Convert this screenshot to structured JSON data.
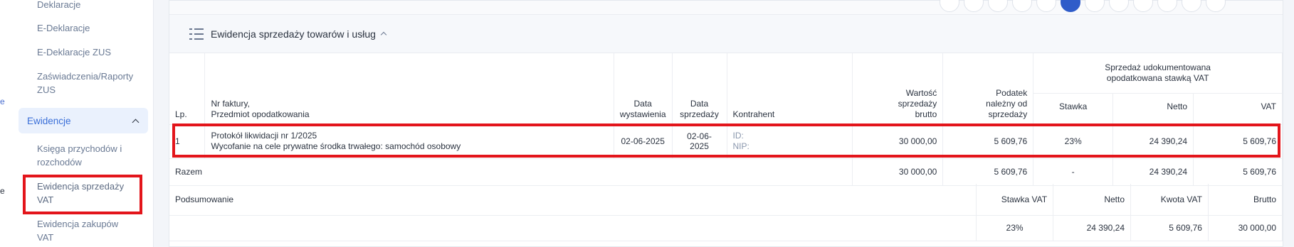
{
  "sidebar": {
    "items": [
      {
        "label": "Deklaracje"
      },
      {
        "label": "E-Deklaracje"
      },
      {
        "label": "E-Deklaracje ZUS"
      },
      {
        "label": "Zaświadczenia/Raporty ZUS"
      },
      {
        "label": "Księga przychodów i rozchodów"
      },
      {
        "label": "Ewidencja sprzedaży VAT"
      },
      {
        "label": "Ewidencja zakupów VAT"
      }
    ],
    "section": "Ewidencje"
  },
  "section": {
    "title": "Ewidencja sprzedaży towarów i usług"
  },
  "table": {
    "headers": {
      "lp": "Lp.",
      "invoice": "Nr faktury,\nPrzedmiot opodatkowania",
      "issue_date": "Data\nwystawienia",
      "sale_date": "Data\nsprzedaży",
      "counterparty": "Kontrahent",
      "gross": "Wartość\nsprzedaży\nbrutto",
      "tax": "Podatek\nnależny od\nsprzedaży",
      "group": "Sprzedaż udokumentowana\nopodatkowana stawką VAT",
      "rate": "Stawka",
      "net": "Netto",
      "vat": "VAT"
    },
    "row": {
      "lp": "1",
      "invoice_no": "Protokół likwidacji nr 1/2025",
      "subject": "Wycofanie na cele prywatne środka trwałego: samochód osobowy",
      "issue_date": "02-06-2025",
      "sale_date": "02-06-2025",
      "id_label": "ID:",
      "nip_label": "NIP:",
      "gross": "30 000,00",
      "tax": "5 609,76",
      "rate": "23%",
      "net": "24 390,24",
      "vat": "5 609,76"
    },
    "total": {
      "label": "Razem",
      "gross": "30 000,00",
      "tax": "5 609,76",
      "rate": "-",
      "net": "24 390,24",
      "vat": "5 609,76"
    }
  },
  "summary": {
    "label": "Podsumowanie",
    "headers": {
      "rate": "Stawka VAT",
      "net": "Netto",
      "vat": "Kwota VAT",
      "gross": "Brutto"
    },
    "row": {
      "rate": "23%",
      "net": "24 390,24",
      "vat": "5 609,76",
      "gross": "30 000,00"
    }
  },
  "colors": {
    "accent": "#2f5cc9",
    "highlight": "#e3151b",
    "active_bg": "#eaf1fd"
  }
}
